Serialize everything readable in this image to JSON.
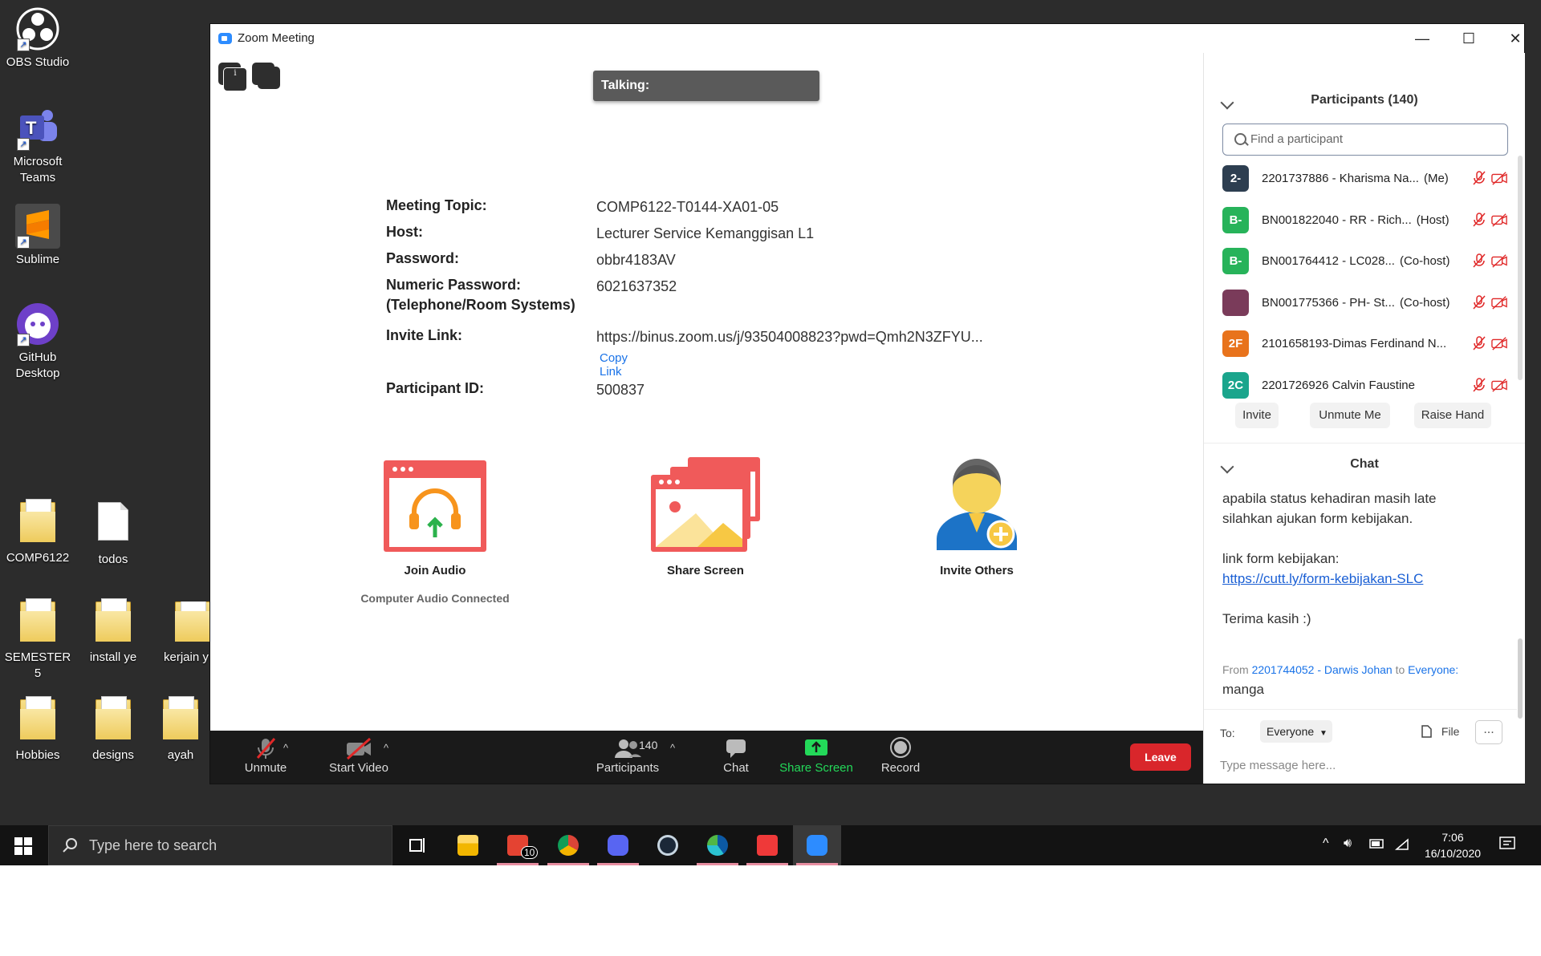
{
  "desktop": {
    "icons": [
      {
        "label": "OBS Studio"
      },
      {
        "label": "Microsoft Teams"
      },
      {
        "label": "Sublime"
      },
      {
        "label": "GitHub Desktop"
      },
      {
        "label": "COMP6122"
      },
      {
        "label": "todos"
      },
      {
        "label": "SEMESTER 5"
      },
      {
        "label": "install ye"
      },
      {
        "label": "kerjain y"
      },
      {
        "label": "Hobbies"
      },
      {
        "label": "designs"
      },
      {
        "label": "ayah"
      }
    ]
  },
  "window": {
    "title": "Zoom Meeting",
    "talking_label": "Talking:"
  },
  "meeting": {
    "topic_label": "Meeting Topic:",
    "topic": "COMP6122-T0144-XA01-05",
    "host_label": "Host:",
    "host": "Lecturer Service Kemanggisan L1",
    "password_label": "Password:",
    "password": "obbr4183AV",
    "numeric_label": "Numeric Password:",
    "numeric_label_2": "(Telephone/Room Systems)",
    "numeric_password": "6021637352",
    "invite_label": "Invite Link:",
    "invite_link": "https://binus.zoom.us/j/93504008823?pwd=Qmh2N3ZFYU...",
    "copy_link": "Copy Link",
    "participant_id_label": "Participant ID:",
    "participant_id": "500837"
  },
  "actions": {
    "join_audio": "Join Audio",
    "audio_status": "Computer Audio Connected",
    "share_screen": "Share Screen",
    "invite_others": "Invite Others"
  },
  "toolbar": {
    "unmute": "Unmute",
    "start_video": "Start Video",
    "participants": "Participants",
    "participants_count": "140",
    "chat": "Chat",
    "share_screen": "Share Screen",
    "record": "Record",
    "leave": "Leave"
  },
  "participants_panel": {
    "title": "Participants (140)",
    "search_placeholder": "Find a participant",
    "list": [
      {
        "initials": "2-",
        "name": "2201737886 - Kharisma Na...",
        "role": "(Me)",
        "color": "#2d3e50"
      },
      {
        "initials": "B-",
        "name": "BN001822040 - RR - Rich...",
        "role": "(Host)",
        "color": "#27b35a"
      },
      {
        "initials": "B-",
        "name": "BN001764412 - LC028...",
        "role": "(Co-host)",
        "color": "#27b35a"
      },
      {
        "initials": "",
        "name": "BN001775366 - PH- St...",
        "role": "(Co-host)",
        "color": "#7a3b5a"
      },
      {
        "initials": "2F",
        "name": "2101658193-Dimas Ferdinand N...",
        "role": "",
        "color": "#e8731c"
      },
      {
        "initials": "2C",
        "name": "2201726926 Calvin Faustine",
        "role": "",
        "color": "#1aa58c"
      }
    ],
    "invite": "Invite",
    "unmute_me": "Unmute Me",
    "raise_hand": "Raise Hand"
  },
  "chat_panel": {
    "title": "Chat",
    "line1": "apabila status kehadiran masih late",
    "line2": "silahkan ajukan form kebijakan.",
    "line3": "link form kebijakan:",
    "link": "https://cutt.ly/form-kebijakan-SLC",
    "line4": "Terima kasih :)",
    "meta_from": "From",
    "meta_sender": "2201744052 - Darwis Johan",
    "meta_to": "to",
    "meta_recipient": "Everyone:",
    "last_message": "manga",
    "to_label": "To:",
    "to_value": "Everyone",
    "file": "File",
    "more": "...",
    "input_placeholder": "Type message here..."
  },
  "taskbar": {
    "search_placeholder": "Type here to search",
    "todoist_badge": "10",
    "time": "7:06",
    "date": "16/10/2020"
  },
  "colors": {
    "accent": "#2d8cff",
    "leave": "#d9262b",
    "share_green": "#23d959",
    "muted_red": "#e02828"
  }
}
